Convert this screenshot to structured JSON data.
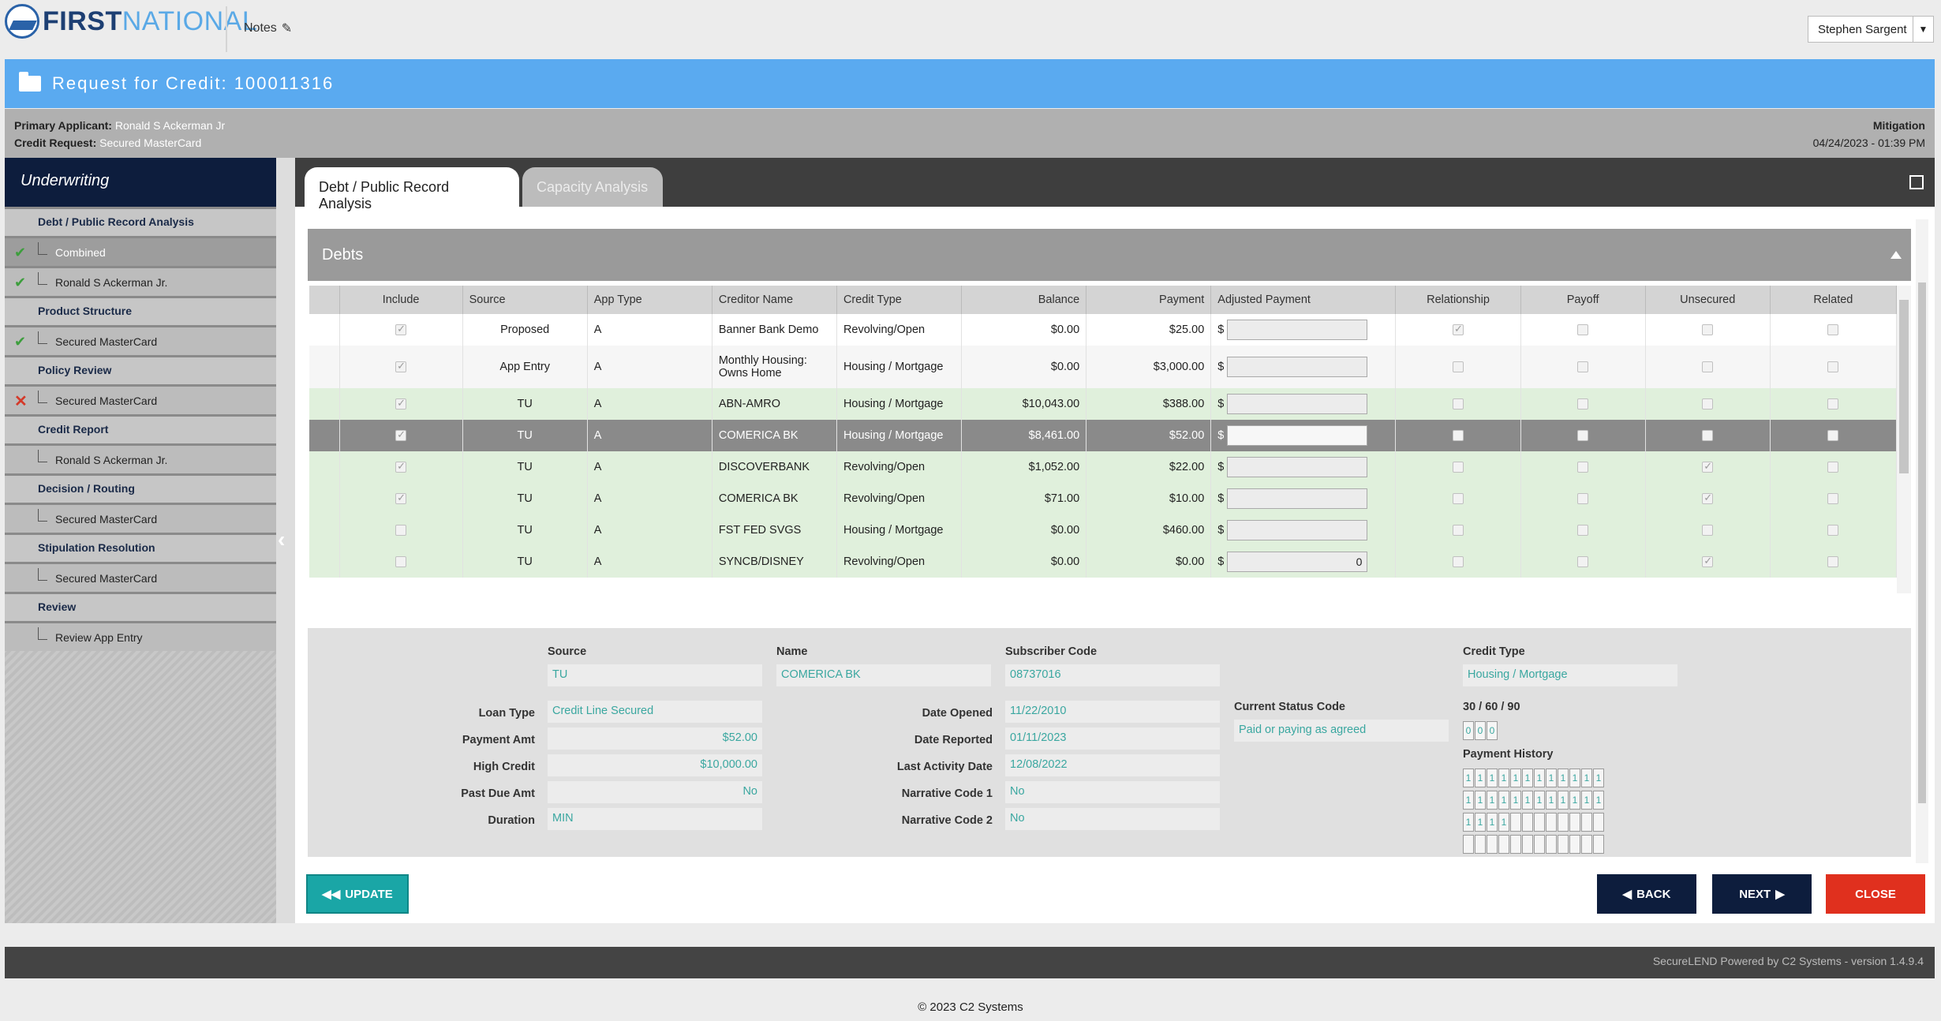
{
  "brand": {
    "first": "FIRST",
    "national": "NATIONAL"
  },
  "header": {
    "notes_label": "Notes",
    "user_name": "Stephen Sargent"
  },
  "banner": {
    "title": "Request for Credit: 100011316"
  },
  "info": {
    "primary_label": "Primary Applicant:",
    "primary_value": "Ronald S Ackerman Jr",
    "credit_label": "Credit Request:",
    "credit_value": "Secured MasterCard",
    "status": "Mitigation",
    "datetime": "04/24/2023 - 01:39 PM"
  },
  "sidebar": {
    "title": "Underwriting",
    "sections": [
      {
        "label": "Debt / Public Record Analysis",
        "items": [
          {
            "label": "Combined",
            "state": "check",
            "active": true
          },
          {
            "label": "Ronald S Ackerman Jr.",
            "state": "check"
          }
        ]
      },
      {
        "label": "Product Structure",
        "items": [
          {
            "label": "Secured MasterCard",
            "state": "check"
          }
        ]
      },
      {
        "label": "Policy Review",
        "items": [
          {
            "label": "Secured MasterCard",
            "state": "x"
          }
        ]
      },
      {
        "label": "Credit Report",
        "items": [
          {
            "label": "Ronald S Ackerman Jr.",
            "state": ""
          }
        ]
      },
      {
        "label": "Decision / Routing",
        "items": [
          {
            "label": "Secured MasterCard",
            "state": ""
          }
        ]
      },
      {
        "label": "Stipulation Resolution",
        "items": [
          {
            "label": "Secured MasterCard",
            "state": ""
          }
        ]
      },
      {
        "label": "Review",
        "items": [
          {
            "label": "Review App Entry",
            "state": ""
          }
        ]
      }
    ]
  },
  "tabs": {
    "active": "Debt / Public Record Analysis",
    "inactive": "Capacity Analysis"
  },
  "debts": {
    "title": "Debts",
    "columns": [
      "Include",
      "Source",
      "App Type",
      "Creditor Name",
      "Credit Type",
      "Balance",
      "Payment",
      "Adjusted Payment",
      "Relationship",
      "Payoff",
      "Unsecured",
      "Related"
    ],
    "rows": [
      {
        "style": "white",
        "include": true,
        "source": "Proposed",
        "app_type": "A",
        "creditor": "Banner Bank Demo",
        "credit_type": "Revolving/Open",
        "balance": "$0.00",
        "payment": "$25.00",
        "adjusted": "",
        "relationship": true,
        "payoff": false,
        "unsecured": false,
        "related": false
      },
      {
        "style": "grey2",
        "tall": true,
        "include": true,
        "source": "App Entry",
        "app_type": "A",
        "creditor": "Monthly Housing: Owns Home",
        "credit_type": "Housing / Mortgage",
        "balance": "$0.00",
        "payment": "$3,000.00",
        "adjusted": "",
        "relationship": false,
        "payoff": false,
        "unsecured": false,
        "related": false
      },
      {
        "style": "green",
        "include": true,
        "source": "TU",
        "app_type": "A",
        "creditor": "ABN-AMRO",
        "credit_type": "Housing / Mortgage",
        "balance": "$10,043.00",
        "payment": "$388.00",
        "adjusted": "",
        "relationship": false,
        "payoff": false,
        "unsecured": false,
        "related": false
      },
      {
        "style": "sel",
        "include": true,
        "source": "TU",
        "app_type": "A",
        "creditor": "COMERICA BK",
        "credit_type": "Housing / Mortgage",
        "balance": "$8,461.00",
        "payment": "$52.00",
        "adjusted": "",
        "relationship": false,
        "payoff": false,
        "unsecured": false,
        "related": false
      },
      {
        "style": "green",
        "include": true,
        "source": "TU",
        "app_type": "A",
        "creditor": "DISCOVERBANK",
        "credit_type": "Revolving/Open",
        "balance": "$1,052.00",
        "payment": "$22.00",
        "adjusted": "",
        "relationship": false,
        "payoff": false,
        "unsecured": true,
        "related": false
      },
      {
        "style": "green",
        "include": true,
        "source": "TU",
        "app_type": "A",
        "creditor": "COMERICA BK",
        "credit_type": "Revolving/Open",
        "balance": "$71.00",
        "payment": "$10.00",
        "adjusted": "",
        "relationship": false,
        "payoff": false,
        "unsecured": true,
        "related": false
      },
      {
        "style": "green",
        "include": false,
        "source": "TU",
        "app_type": "A",
        "creditor": "FST FED SVGS",
        "credit_type": "Housing / Mortgage",
        "balance": "$0.00",
        "payment": "$460.00",
        "adjusted": "",
        "relationship": false,
        "payoff": false,
        "unsecured": false,
        "related": false
      },
      {
        "style": "green",
        "include": false,
        "source": "TU",
        "app_type": "A",
        "creditor": "SYNCB/DISNEY",
        "credit_type": "Revolving/Open",
        "balance": "$0.00",
        "payment": "$0.00",
        "adjusted": "0",
        "relationship": false,
        "payoff": false,
        "unsecured": true,
        "related": false
      }
    ],
    "currency_symbol": "$"
  },
  "detail": {
    "source_label": "Source",
    "source": "TU",
    "name_label": "Name",
    "name": "COMERICA BK",
    "subscriber_label": "Subscriber Code",
    "subscriber": "08737016",
    "credit_type_label": "Credit Type",
    "credit_type": "Housing / Mortgage",
    "loan_type_label": "Loan Type",
    "loan_type": "Credit Line Secured",
    "payment_amt_label": "Payment Amt",
    "payment_amt": "$52.00",
    "high_credit_label": "High Credit",
    "high_credit": "$10,000.00",
    "past_due_label": "Past Due Amt",
    "past_due": "No",
    "duration_label": "Duration",
    "duration": "MIN",
    "date_opened_label": "Date Opened",
    "date_opened": "11/22/2010",
    "date_reported_label": "Date Reported",
    "date_reported": "01/11/2023",
    "last_activity_label": "Last Activity Date",
    "last_activity": "12/08/2022",
    "narr1_label": "Narrative Code 1",
    "narr1": "No",
    "narr2_label": "Narrative Code 2",
    "narr2": "No",
    "status_code_label": "Current Status Code",
    "status_code": "Paid or paying as agreed",
    "delinq_label": "30 / 60 / 90",
    "delinq": [
      "0",
      "0",
      "0"
    ],
    "history_label": "Payment History",
    "history_rows": [
      [
        "1",
        "1",
        "1",
        "1",
        "1",
        "1",
        "1",
        "1",
        "1",
        "1",
        "1",
        "1"
      ],
      [
        "1",
        "1",
        "1",
        "1",
        "1",
        "1",
        "1",
        "1",
        "1",
        "1",
        "1",
        "1"
      ],
      [
        "1",
        "1",
        "1",
        "1",
        "",
        "",
        "",
        "",
        "",
        "",
        "",
        ""
      ],
      [
        "",
        "",
        "",
        "",
        "",
        "",
        "",
        "",
        "",
        "",
        "",
        ""
      ]
    ]
  },
  "buttons": {
    "update": "UPDATE",
    "back": "BACK",
    "next": "NEXT",
    "close": "CLOSE"
  },
  "footer": {
    "powered": "SecureLEND Powered by C2 Systems - version 1.4.9.4",
    "copyright": "© 2023 C2 Systems"
  }
}
